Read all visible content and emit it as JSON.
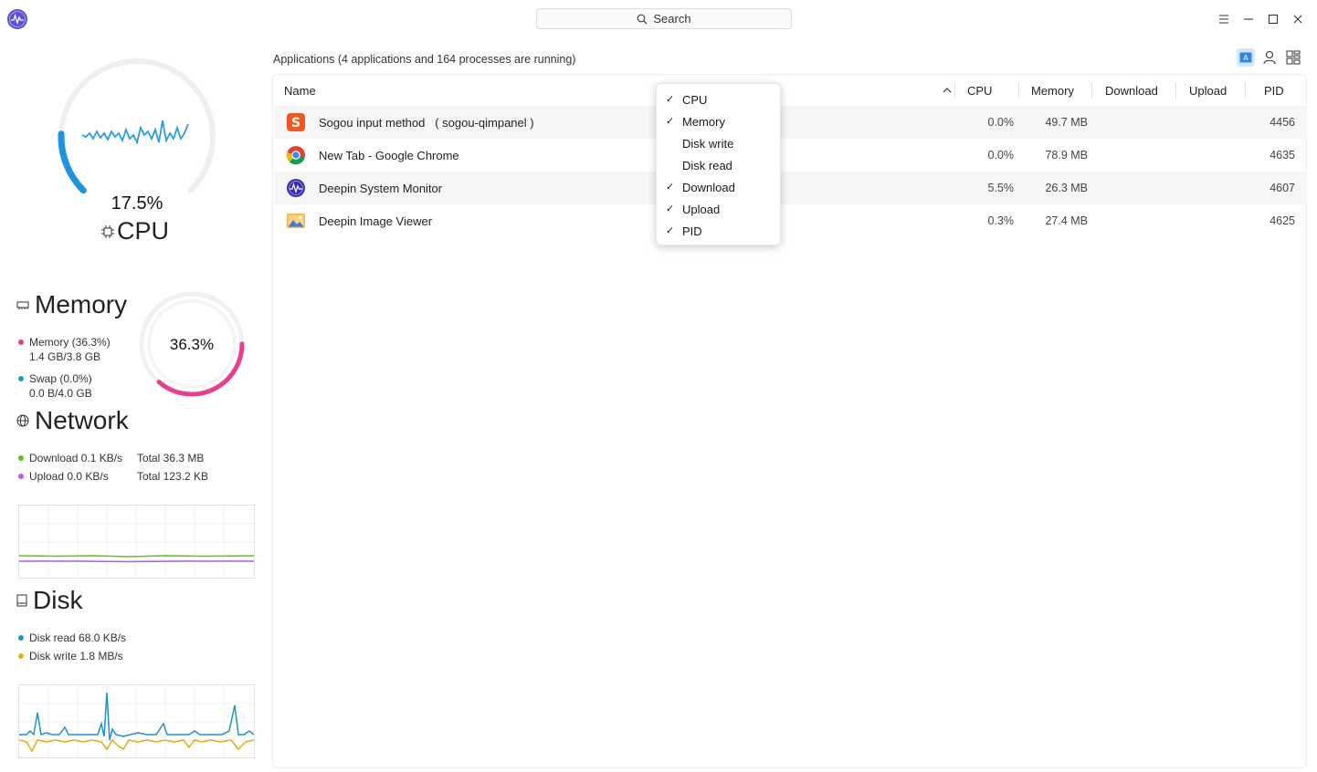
{
  "app": {
    "search_label": "Search",
    "logo_icon": "system-monitor-logo-icon",
    "window_controls": [
      "menu-icon",
      "minimize-icon",
      "maximize-icon",
      "close-icon"
    ]
  },
  "sidebar": {
    "cpu": {
      "percent_text": "17.5%",
      "label": "CPU",
      "usage": 0.175
    },
    "memory": {
      "title": "Memory",
      "percent_text": "36.3%",
      "usage": 0.363,
      "mem_legend": "Memory (36.3%)",
      "mem_detail": "1.4 GB/3.8 GB",
      "swap_legend": "Swap (0.0%)",
      "swap_detail": "0.0 B/4.0 GB",
      "mem_color": "#e83e8c",
      "swap_color": "#1aa3b5"
    },
    "network": {
      "title": "Network",
      "download": "Download 0.1 KB/s",
      "download_total": "Total 36.3 MB",
      "upload": "Upload 0.0 KB/s",
      "upload_total": "Total 123.2 KB",
      "download_color": "#5ec21f",
      "upload_color": "#b65be6"
    },
    "disk": {
      "title": "Disk",
      "read": "Disk read 68.0 KB/s",
      "write": "Disk write 1.8 MB/s",
      "read_color": "#1e93c6",
      "write_color": "#e6ac12"
    }
  },
  "main": {
    "summary": "Applications (4 applications and 164 processes are running)",
    "view_buttons": [
      "application-view-icon",
      "user-view-icon",
      "service-view-icon"
    ],
    "columns": {
      "name": "Name",
      "cpu": "CPU",
      "memory": "Memory",
      "download": "Download",
      "upload": "Upload",
      "pid": "PID"
    },
    "rows": [
      {
        "name": "Sogou input method   ( sogou-qimpanel )",
        "cpu": "0.0%",
        "memory": "49.7 MB",
        "download": "",
        "upload": "",
        "pid": "4456",
        "icon": "sogou-icon"
      },
      {
        "name": "New Tab - Google Chrome",
        "cpu": "0.0%",
        "memory": "78.9 MB",
        "download": "",
        "upload": "",
        "pid": "4635",
        "icon": "chrome-icon"
      },
      {
        "name": "Deepin System Monitor",
        "cpu": "5.5%",
        "memory": "26.3 MB",
        "download": "",
        "upload": "",
        "pid": "4607",
        "icon": "system-monitor-icon"
      },
      {
        "name": "Deepin Image Viewer",
        "cpu": "0.3%",
        "memory": "27.4 MB",
        "download": "",
        "upload": "",
        "pid": "4625",
        "icon": "image-viewer-icon"
      }
    ]
  },
  "column_menu": {
    "items": [
      {
        "label": "CPU",
        "checked": true
      },
      {
        "label": "Memory",
        "checked": true
      },
      {
        "label": "Disk write",
        "checked": false
      },
      {
        "label": "Disk read",
        "checked": false
      },
      {
        "label": "Download",
        "checked": true
      },
      {
        "label": "Upload",
        "checked": true
      },
      {
        "label": "PID",
        "checked": true
      }
    ]
  }
}
